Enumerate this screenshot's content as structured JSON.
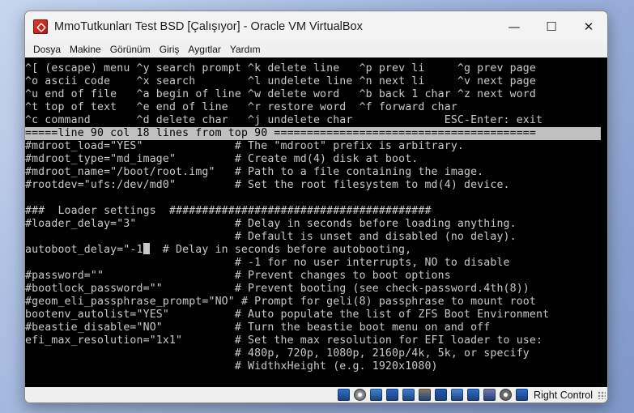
{
  "window": {
    "title": "MmoTutkunları Test BSD [Çalışıyor] - Oracle VM VirtualBox",
    "minimize_glyph": "—",
    "maximize_glyph": "☐",
    "close_glyph": "✕"
  },
  "menu": [
    "Dosya",
    "Makine",
    "Görünüm",
    "Giriş",
    "Aygıtlar",
    "Yardım"
  ],
  "terminal": {
    "lines": [
      "^[ (escape) menu ^y search prompt ^k delete line   ^p prev li     ^g prev page",
      "^o ascii code    ^x search        ^l undelete line ^n next li     ^v next page",
      "^u end of file   ^a begin of line ^w delete word   ^b back 1 char ^z next word",
      "^t top of text   ^e end of line   ^r restore word  ^f forward char",
      "^c command       ^d delete char   ^j undelete char              ESC-Enter: exit",
      "=====line 90 col 18 lines from top 90 ========================================",
      "#mdroot_load=\"YES\"              # The \"mdroot\" prefix is arbitrary.",
      "#mdroot_type=\"md_image\"         # Create md(4) disk at boot.",
      "#mdroot_name=\"/boot/root.img\"   # Path to a file containing the image.",
      "#rootdev=\"ufs:/dev/md0\"         # Set the root filesystem to md(4) device.",
      "",
      "###  Loader settings  ########################################",
      "#loader_delay=\"3\"               # Delay in seconds before loading anything.",
      "                                # Default is unset and disabled (no delay).",
      "autoboot_delay=\"-1",
      "                                # -1 for no user interrupts, NO to disable",
      "#password=\"\"                    # Prevent changes to boot options",
      "#bootlock_password=\"\"           # Prevent booting (see check-password.4th(8))",
      "#geom_eli_passphrase_prompt=\"NO\" # Prompt for geli(8) passphrase to mount root",
      "bootenv_autolist=\"YES\"          # Auto populate the list of ZFS Boot Environment",
      "#beastie_disable=\"NO\"           # Turn the beastie boot menu on and off",
      "efi_max_resolution=\"1x1\"        # Set the max resolution for EFI loader to use:",
      "                                # 480p, 720p, 1080p, 2160p/4k, 5k, or specify",
      "                                # WidthxHeight (e.g. 1920x1080)"
    ],
    "cursor_line_rest": "  # Delay in seconds before autobooting,",
    "highlight_line_index": 5
  },
  "statusbar": {
    "host_key_label": "Right Control",
    "icons": [
      {
        "name": "hard-disk-icon",
        "color": "#2f6fd1"
      },
      {
        "name": "optical-disk-icon",
        "color": "#9aa0a8"
      },
      {
        "name": "audio-icon",
        "color": "#3a8bd6"
      },
      {
        "name": "network-icon",
        "color": "#2a66c9"
      },
      {
        "name": "usb-icon",
        "color": "#3f7fd8"
      },
      {
        "name": "shared-folders-icon",
        "color": "#8a7a5e"
      },
      {
        "name": "display-icon",
        "color": "#1f5bb8"
      },
      {
        "name": "video-capture-icon",
        "color": "#4a8ad8"
      },
      {
        "name": "mouse-integration-icon",
        "color": "#2d6fd0"
      },
      {
        "name": "cpu-icon",
        "color": "#7a7ab0"
      },
      {
        "name": "record-icon",
        "color": "#707070"
      },
      {
        "name": "host-key-arrow-icon",
        "color": "#2b6cd4"
      }
    ]
  }
}
